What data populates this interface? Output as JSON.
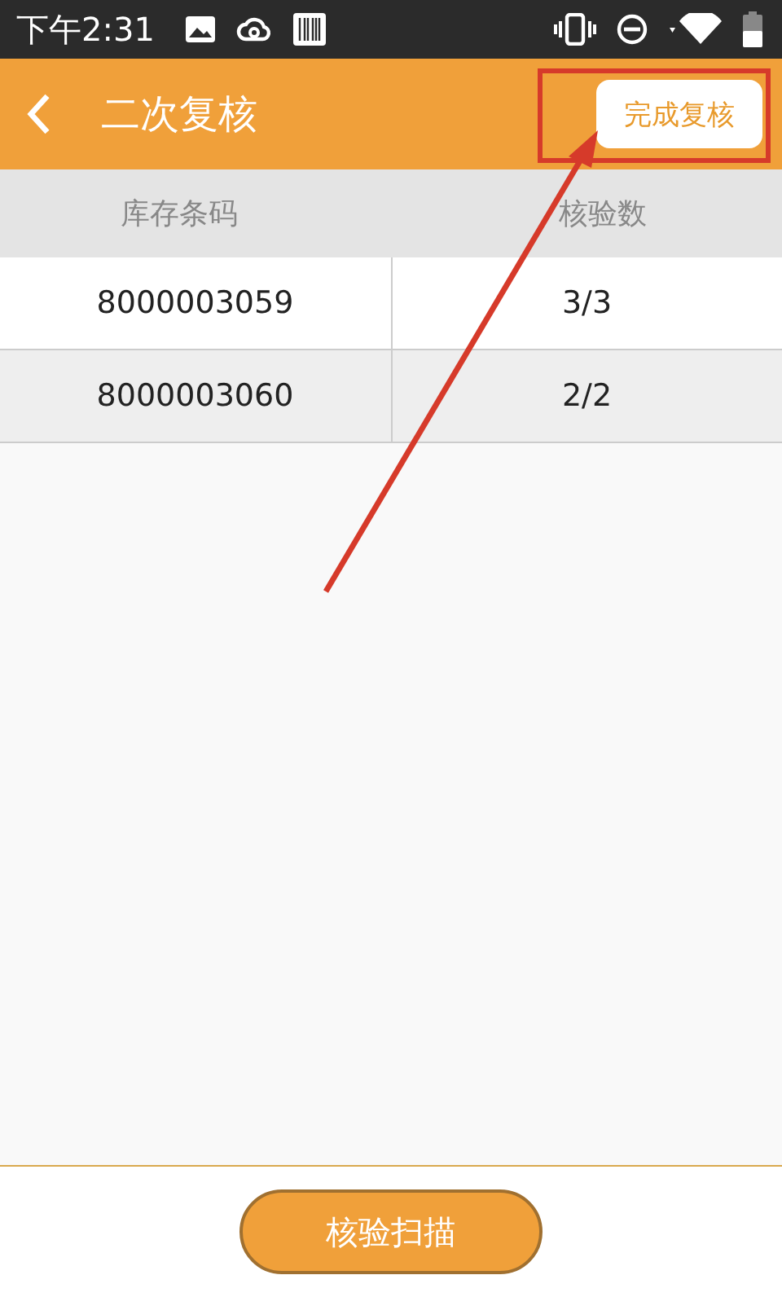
{
  "status_bar": {
    "time": "下午2:31"
  },
  "header": {
    "title": "二次复核",
    "action": "完成复核"
  },
  "table": {
    "columns": [
      "库存条码",
      "核验数"
    ],
    "rows": [
      {
        "cells": [
          "8000003059",
          "3/3"
        ]
      },
      {
        "cells": [
          "8000003060",
          "2/2"
        ]
      }
    ]
  },
  "footer": {
    "button": "核验扫描"
  }
}
